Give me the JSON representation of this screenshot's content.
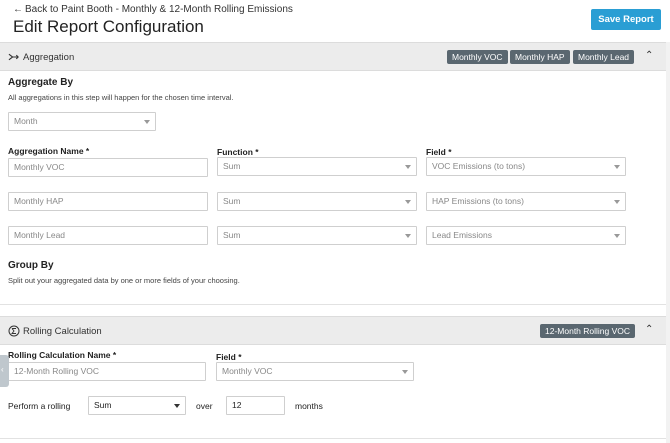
{
  "header": {
    "back_label": "Back to Paint Booth - Monthly & 12-Month Rolling Emissions",
    "title": "Edit Report Configuration",
    "save_label": "Save Report"
  },
  "aggregation": {
    "title": "Aggregation",
    "chips": [
      "Monthly VOC",
      "Monthly HAP",
      "Monthly Lead"
    ],
    "aggregate_by_heading": "Aggregate By",
    "aggregate_by_help": "All aggregations in this step will happen for the chosen time interval.",
    "interval_placeholder": "Month",
    "col_name": "Aggregation Name *",
    "col_function": "Function *",
    "col_field": "Field *",
    "rows": [
      {
        "name": "Monthly VOC",
        "function": "Sum",
        "field": "VOC Emissions (to tons)"
      },
      {
        "name": "Monthly HAP",
        "function": "Sum",
        "field": "HAP Emissions (to tons)"
      },
      {
        "name": "Monthly Lead",
        "function": "Sum",
        "field": "Lead Emissions"
      }
    ],
    "group_by_heading": "Group By",
    "group_by_help": "Split out your aggregated data by one or more fields of your choosing."
  },
  "rolling": {
    "title": "Rolling Calculation",
    "chip": "12-Month Rolling VOC",
    "name_label": "Rolling Calculation Name *",
    "name_value": "12-Month Rolling VOC",
    "field_label": "Field *",
    "field_value": "Monthly VOC",
    "perform_label": "Perform a rolling",
    "function_value": "Sum",
    "over_label": "over",
    "period_value": "12",
    "unit_label": "months"
  },
  "icons": {
    "back": "arrow-left-icon",
    "aggregation": "merge-arrow-icon",
    "rolling": "sigma-icon",
    "collapse": "chevron-up-icon",
    "dropdown": "caret-down-icon"
  },
  "colors": {
    "accent": "#2a9ed4",
    "chip": "#5a6770",
    "section_bar": "#ececec"
  }
}
